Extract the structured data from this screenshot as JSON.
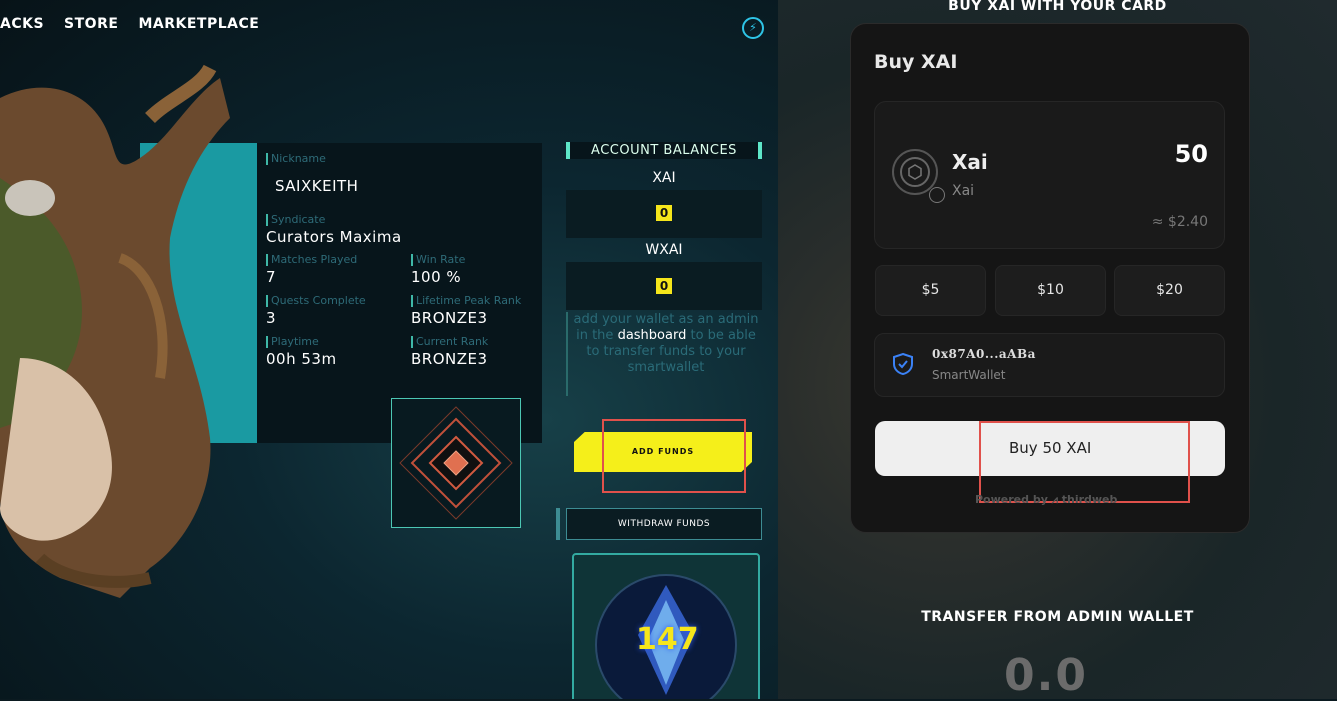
{
  "nav": {
    "items": [
      "ACKS",
      "STORE",
      "MARKETPLACE"
    ]
  },
  "profile": {
    "nickname_label": "Nickname",
    "nickname": "SAIXKEITH",
    "syndicate_label": "Syndicate",
    "syndicate": "Curators Maxima",
    "matches_label": "Matches Played",
    "matches": "7",
    "winrate_label": "Win Rate",
    "winrate": "100 %",
    "quests_label": "Quests Complete",
    "quests": "3",
    "peak_rank_label": "Lifetime Peak Rank",
    "peak_rank": "BRONZE3",
    "playtime_label": "Playtime",
    "playtime": "00h 53m",
    "current_rank_label": "Current Rank",
    "current_rank": "BRONZE3"
  },
  "balances": {
    "header": "ACCOUNT BALANCES",
    "xai_label": "XAI",
    "xai_value": "0",
    "wxai_label": "WXAI",
    "wxai_value": "0",
    "note_pre": "add your wallet as an admin in the",
    "note_link": "dashboard",
    "note_post": "to be able to transfer funds to your smartwallet"
  },
  "buttons": {
    "add_funds": "ADD FUNDS",
    "withdraw": "WITHDRAW FUNDS"
  },
  "card": {
    "number": "147"
  },
  "right": {
    "top_title": "BUY XAI WITH YOUR CARD",
    "panel_title": "Buy XAI",
    "token_name": "Xai",
    "token_sub": "Xai",
    "token_amount": "50",
    "token_usd": "≈ $2.40",
    "presets": [
      "$5",
      "$10",
      "$20"
    ],
    "wallet_address": "0x87A0...aABa",
    "wallet_type": "SmartWallet",
    "buy_button": "Buy 50 XAI",
    "powered_by": "Powered by ⩘ thirdweb",
    "transfer_title": "TRANSFER FROM ADMIN WALLET",
    "transfer_value": "0.0"
  },
  "colors": {
    "accent_yellow": "#f5ef1a",
    "accent_teal": "#5ee6c8",
    "highlight_red": "#e0514b"
  }
}
